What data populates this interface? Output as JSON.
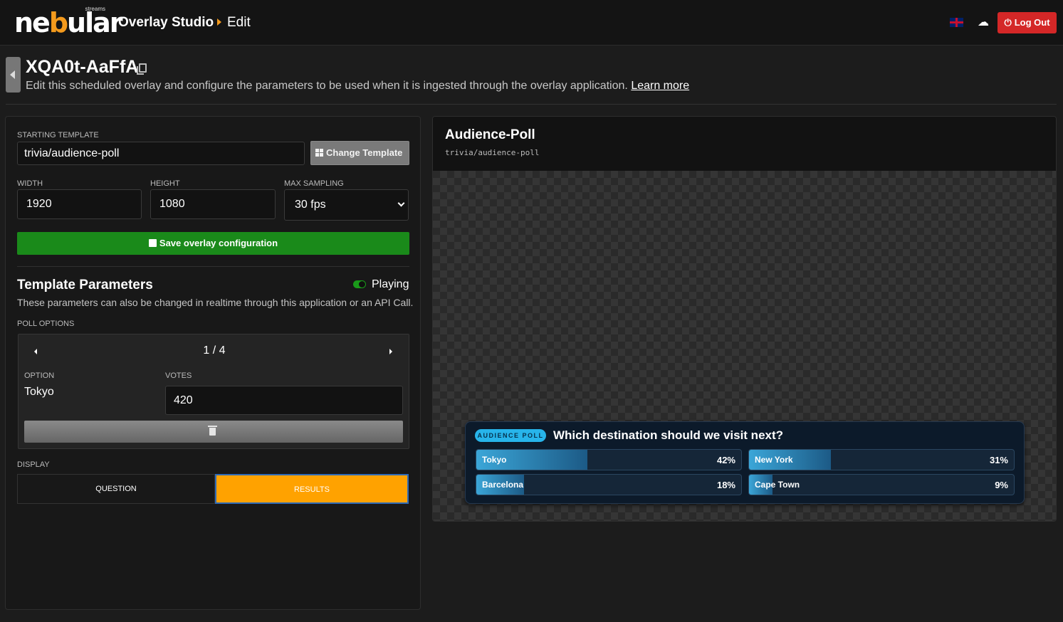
{
  "topbar": {
    "logo_text": "nebular",
    "logo_sub": "streams",
    "app_title": "Overlay Studio",
    "breadcrumb": "Edit",
    "language_icon": "uk-flag-icon",
    "upload_icon": "upload-cloud-icon",
    "logout_label": "Log Out",
    "logout_color": "#d42727"
  },
  "header": {
    "overlay_id": "XQA0t-AaFfA",
    "description": "Edit this scheduled overlay and configure the parameters to be used when it is ingested through the overlay application.",
    "learn_more": "Learn more"
  },
  "config": {
    "starting_template_label": "STARTING TEMPLATE",
    "starting_template_value": "trivia/audience-poll",
    "change_template_label": "Change Template",
    "width_label": "WIDTH",
    "width_value": "1920",
    "height_label": "HEIGHT",
    "height_value": "1080",
    "max_sampling_label": "MAX SAMPLING",
    "max_sampling_value": "30 fps",
    "save_label": "Save overlay configuration",
    "save_color": "#1a8a1a"
  },
  "params": {
    "title": "Template Parameters",
    "playing_label": "Playing",
    "playing": true,
    "description": "These parameters can also be changed in realtime through this application or an API Call.",
    "poll_options_label": "POLL OPTIONS",
    "pager": "1 / 4",
    "option_label": "OPTION",
    "option_value": "Tokyo",
    "votes_label": "VOTES",
    "votes_value": "420",
    "display_label": "DISPLAY",
    "display_options": [
      "QUESTION",
      "RESULTS"
    ],
    "display_selected": "RESULTS",
    "accent_color": "#ffa200"
  },
  "preview": {
    "title": "Audience-Poll",
    "path": "trivia/audience-poll",
    "poll": {
      "badge": "AUDIENCE POLL",
      "question": "Which destination should we visit next?",
      "results": [
        {
          "name": "Tokyo",
          "percent_label": "42%",
          "percent": 42
        },
        {
          "name": "New York",
          "percent_label": "31%",
          "percent": 31
        },
        {
          "name": "Barcelona",
          "percent_label": "18%",
          "percent": 18
        },
        {
          "name": "Cape Town",
          "percent_label": "9%",
          "percent": 9
        }
      ]
    }
  }
}
